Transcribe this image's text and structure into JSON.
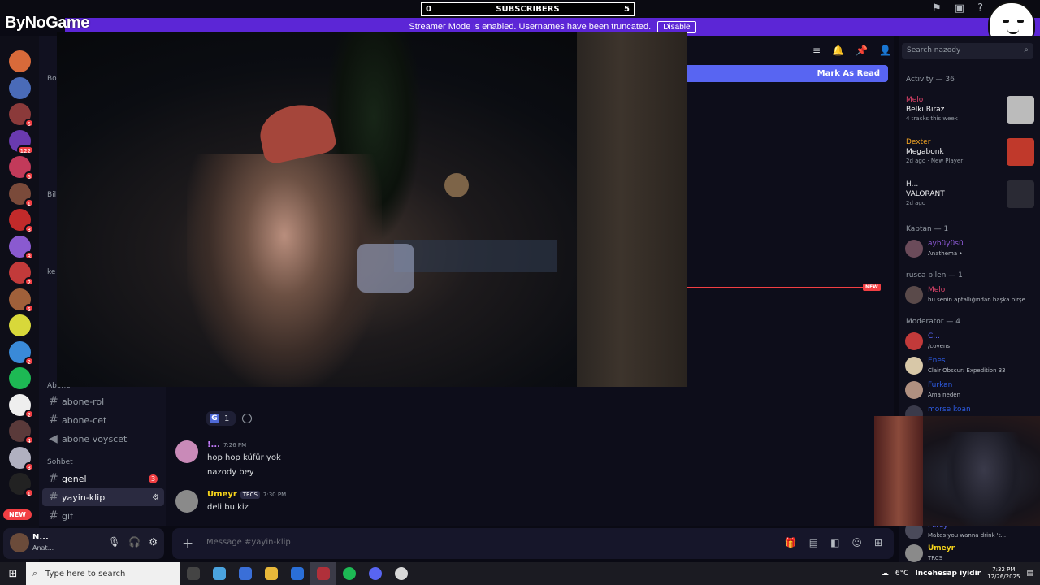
{
  "overlay": {
    "subs_left": "0",
    "subs_label": "SUBSCRIBERS",
    "subs_right": "5",
    "logo": "ByNoGame",
    "banner_text": "Streamer Mode is enabled. Usernames have been truncated.",
    "disable_label": "Disable"
  },
  "rail": {
    "servers": [
      {
        "color": "#d86a3a",
        "badge": ""
      },
      {
        "color": "#4a6bb8",
        "badge": ""
      },
      {
        "color": "#8b3a3a",
        "badge": "5"
      },
      {
        "color": "#6a3ab0",
        "badge": "122"
      },
      {
        "color": "#c23a5a",
        "badge": "6"
      },
      {
        "color": "#7a4a3a",
        "badge": "1"
      },
      {
        "color": "#c22a2a",
        "badge": "8"
      },
      {
        "color": "#8a5ad0",
        "badge": "8"
      },
      {
        "color": "#c23a3a",
        "badge": "2"
      },
      {
        "color": "#a0603a",
        "badge": "5"
      },
      {
        "color": "#d8d83a",
        "badge": ""
      },
      {
        "color": "#3a8ad8",
        "badge": "2"
      },
      {
        "color": "#1db954",
        "badge": ""
      },
      {
        "color": "#eeeeee",
        "badge": "2"
      },
      {
        "color": "#5a3a3a",
        "badge": "4"
      },
      {
        "color": "#b0b0c0",
        "badge": "3"
      },
      {
        "color": "#222222",
        "badge": "1"
      }
    ],
    "new_label": "NEW"
  },
  "sidebar": {
    "partial_labels": [
      "Bo",
      "Bil",
      "ke"
    ],
    "cat_abone": "Abone",
    "cat_sohbet": "Sohbet",
    "channels": [
      {
        "label": "abone-rol",
        "type": "text",
        "badge": ""
      },
      {
        "label": "abone-cet",
        "type": "text",
        "badge": ""
      },
      {
        "label": "abone voyscet",
        "type": "voice",
        "badge": ""
      },
      {
        "label": "genel",
        "type": "text",
        "badge": "3"
      },
      {
        "label": "yayin-klip",
        "type": "text",
        "badge": ""
      },
      {
        "label": "gif",
        "type": "text",
        "badge": ""
      }
    ]
  },
  "user_panel": {
    "name": "N...",
    "status": "Anat..."
  },
  "chat": {
    "mark_as_read": "Mark As Read",
    "new_divider": "NEW",
    "reaction_letter": "G",
    "reaction_count": "1",
    "messages": [
      {
        "author": "!...",
        "author_color": "#c77dff",
        "time": "7:26 PM",
        "tag": "",
        "lines": [
          "hop hop küfür yok",
          "nazody bey"
        ]
      },
      {
        "author": "Umeyr",
        "author_color": "#f5d31b",
        "time": "7:30 PM",
        "tag": "TRCS",
        "lines": [
          "deli bu kiz"
        ]
      }
    ],
    "composer_placeholder": "Message #yayin-klip"
  },
  "right_panel": {
    "search_placeholder": "Search nazody",
    "activity_header": "Activity — 36",
    "activities": [
      {
        "user": "Melo",
        "user_color": "#e0446b",
        "title": "Belki Biraz",
        "sub": "4 tracks this week",
        "thumb_color": "#bbbbbb"
      },
      {
        "user": "Dexter",
        "user_color": "#f5a623",
        "title": "Megabonk",
        "sub": "2d ago · New Player",
        "thumb_color": "#c0392b"
      },
      {
        "user": "H...",
        "user_color": "#dbdee1",
        "title": "VALORANT",
        "sub": "2d ago",
        "thumb_color": "#2a2a34"
      }
    ],
    "groups": [
      {
        "header": "Kaptan — 1",
        "members": [
          {
            "name": "aybüyüsü",
            "color": "#8e5ad8",
            "status": "Anathema •"
          }
        ]
      },
      {
        "header": "rusca bilen — 1",
        "members": [
          {
            "name": "Melo",
            "color": "#e0446b",
            "status": "bu senin aptallığından başka birşe..."
          }
        ]
      },
      {
        "header": "Moderator — 4",
        "members": [
          {
            "name": "C...",
            "color": "#5865f2",
            "status": "/covens"
          },
          {
            "name": "Enes",
            "color": "#2d5be3",
            "status": "Clair Obscur: Expedition 33"
          },
          {
            "name": "Furkan",
            "color": "#2d5be3",
            "status": "Ama neden"
          },
          {
            "name": "morse koan",
            "color": "#2d5be3",
            "status": ""
          }
        ]
      }
    ],
    "bottom_members": [
      {
        "name": "Mirey",
        "color": "#5865f2",
        "status": "Makes you wanna drink 't..."
      },
      {
        "name": "Umeyr",
        "color": "#f5d31b",
        "status": "TRCS"
      }
    ]
  },
  "taskbar": {
    "search_placeholder": "Type here to search",
    "weather": "6°C",
    "news": "Incehesap iyidir",
    "time": "7:32 PM",
    "date": "12/26/2025"
  }
}
